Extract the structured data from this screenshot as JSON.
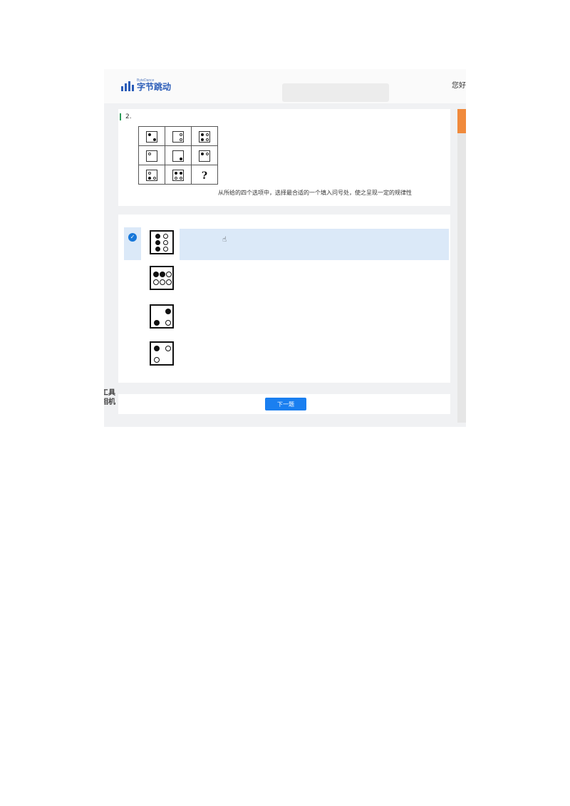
{
  "header": {
    "logo_en": "ByteDance",
    "logo_cn": "字节跳动",
    "greeting": "您好"
  },
  "question": {
    "number": "2.",
    "matrix_placeholder": "?",
    "text": "从所给的四个选项中，选择最合适的一个填入问号处，使之呈现一定的规律性",
    "matrix_cells": [
      [
        "filled top-left, filled bottom-right",
        "hollow top-right, hollow bottom-right",
        "filled top-left, hollow top-right, filled bottom-left, hollow bottom-right"
      ],
      [
        "hollow top-left",
        "filled bottom-right",
        "filled top-left, hollow top-right"
      ],
      [
        "hollow top-left, filled bottom-left, hollow bottom-right",
        "filled top-left, filled top-right, hollow bottom-left, hollow bottom-right",
        "?"
      ]
    ]
  },
  "options": [
    {
      "selected": true,
      "figure": "3 filled left column, 3 hollow right column"
    },
    {
      "selected": false,
      "figure": "2 filled, 1 hollow top row; 3 hollow bottom row"
    },
    {
      "selected": false,
      "figure": "filled top-right, filled bottom-left, hollow bottom-right"
    },
    {
      "selected": false,
      "figure": "filled top-left, hollow top-right, hollow bottom-left"
    }
  ],
  "footer": {
    "next_label": "下一题"
  },
  "watermark": {
    "line1": "工具",
    "line2": "相机"
  },
  "colors": {
    "accent": "#1a7ff0",
    "selected_bg": "#dbe9f8",
    "brand": "#2a5cb8",
    "scroll_thumb": "#f08a3c"
  }
}
